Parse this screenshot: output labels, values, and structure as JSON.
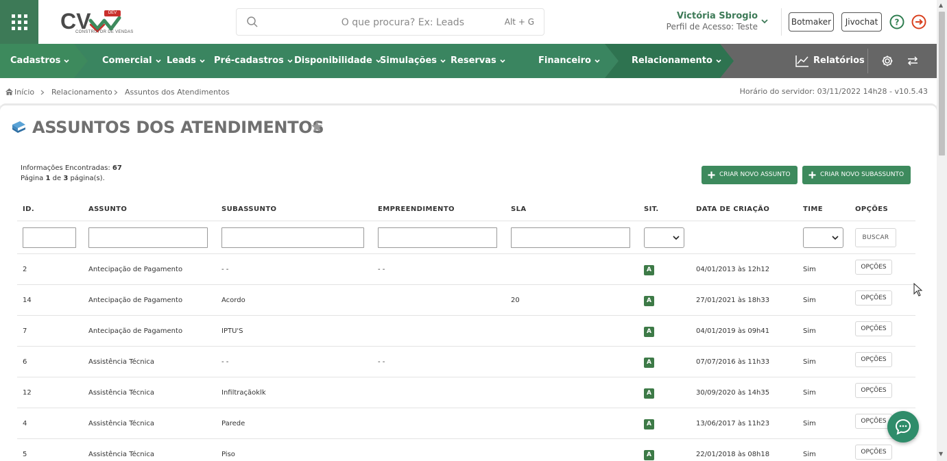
{
  "header": {
    "logo_text": "CV",
    "logo_badge": "DEV",
    "logo_subtitle": "CONSTRUTOR DE VENDAS",
    "search_placeholder": "O que procura? Ex: Leads",
    "search_shortcut": "Alt + G",
    "user_name": "Victória Sbrogio",
    "user_profile": "Perfil de Acesso: Teste",
    "botmaker_label": "Botmaker",
    "jivochat_label": "Jivochat"
  },
  "nav": {
    "items": [
      {
        "label": "Cadastros"
      },
      {
        "label": "Comercial"
      },
      {
        "label": "Leads"
      },
      {
        "label": "Pré-cadastros"
      },
      {
        "label": "Disponibilidade"
      },
      {
        "label": "Simulações"
      },
      {
        "label": "Reservas"
      },
      {
        "label": "Financeiro"
      },
      {
        "label": "Relacionamento"
      }
    ],
    "reports_label": "Relatórios",
    "colors": {
      "segment_green": "#3d8a5d",
      "segment_mid": "#3a8560",
      "segment_dark": "#2e7350",
      "gray": "#666666"
    }
  },
  "breadcrumb": {
    "items": [
      "Início",
      "Relacionamento",
      "Assuntos dos Atendimentos"
    ],
    "server_time": "Horário do servidor: 03/11/2022 14h28 - v10.5.43"
  },
  "page": {
    "title": "ASSUNTOS DOS ATENDIMENTOS",
    "info_found_label": "Informações Encontradas:",
    "info_found_value": "67",
    "page_word": "Página",
    "page_current": "1",
    "page_of": "de",
    "page_total": "3",
    "page_suffix": "página(s).",
    "create_subject_label": "CRIAR NOVO ASSUNTO",
    "create_subsubject_label": "CRIAR NOVO SUBASSUNTO"
  },
  "table": {
    "columns": [
      "ID.",
      "ASSUNTO",
      "SUBASSUNTO",
      "EMPREENDIMENTO",
      "SLA",
      "SIT.",
      "DATA DE CRIAÇÃO",
      "TIME",
      "OPÇÕES"
    ],
    "search_label": "BUSCAR",
    "options_label": "OPÇÕES",
    "rows": [
      {
        "id": "2",
        "assunto": "Antecipação de Pagamento",
        "subassunto": "- -",
        "empreendimento": "- -",
        "sla": "",
        "sit": "A",
        "data": "04/01/2013 às 12h12",
        "time": "Sim"
      },
      {
        "id": "14",
        "assunto": "Antecipação de Pagamento",
        "subassunto": "Acordo",
        "empreendimento": "",
        "sla": "20",
        "sit": "A",
        "data": "27/01/2021 às 18h33",
        "time": "Sim"
      },
      {
        "id": "7",
        "assunto": "Antecipação de Pagamento",
        "subassunto": "IPTU'S",
        "empreendimento": "",
        "sla": "",
        "sit": "A",
        "data": "04/01/2019 às 09h41",
        "time": "Sim"
      },
      {
        "id": "6",
        "assunto": "Assistência Técnica",
        "subassunto": "- -",
        "empreendimento": "- -",
        "sla": "",
        "sit": "A",
        "data": "07/07/2016 às 11h33",
        "time": "Sim"
      },
      {
        "id": "12",
        "assunto": "Assistência Técnica",
        "subassunto": "Infiltraçãoklk",
        "empreendimento": "",
        "sla": "",
        "sit": "A",
        "data": "30/09/2020 às 14h35",
        "time": "Sim"
      },
      {
        "id": "4",
        "assunto": "Assistência Técnica",
        "subassunto": "Parede",
        "empreendimento": "",
        "sla": "",
        "sit": "A",
        "data": "13/06/2017 às 11h23",
        "time": "Sim"
      },
      {
        "id": "5",
        "assunto": "Assistência Técnica",
        "subassunto": "Piso",
        "empreendimento": "",
        "sla": "",
        "sit": "A",
        "data": "22/01/2018 às 08h18",
        "time": "Sim"
      }
    ],
    "status_color": "#3d7a47"
  },
  "icons": {
    "apps": "apps-grid-icon",
    "search": "search-icon",
    "chevron": "chevron-down-icon",
    "help": "help-icon",
    "logout": "logout-icon",
    "reports": "line-chart-icon",
    "settings": "gear-icon",
    "swap": "swap-icon",
    "home": "home-icon",
    "star": "star-icon",
    "chat": "chat-icon"
  },
  "accent": "#3d7a57"
}
